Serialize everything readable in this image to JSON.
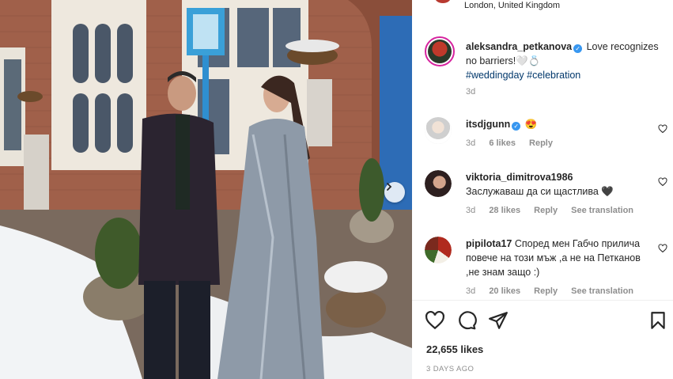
{
  "post": {
    "location": "London, United Kingdom",
    "author": "aleksandra_petkanova",
    "caption_text": "Love recognizes no barriers!🤍💍",
    "hashtags": "#weddingday #celebration",
    "time_ago": "3d",
    "likes": "22,655 likes",
    "date": "3 DAYS AGO"
  },
  "comments": [
    {
      "username": "itsdjgunn",
      "verified": true,
      "text": "😍",
      "time": "3d",
      "likes": "6 likes",
      "reply": "Reply",
      "avatar_color": "#d9d9d9"
    },
    {
      "username": "viktoria_dimitrova1986",
      "verified": false,
      "text": "Заслужаваш да си щастлива 🖤",
      "time": "3d",
      "likes": "28 likes",
      "reply": "Reply",
      "translate": "See translation",
      "avatar_color": "#3a2b2b"
    },
    {
      "username": "pipilota17",
      "verified": false,
      "text": "Според мен Габчо прилича повече на този мъж ,а не на Петканов ,не знам защо :)",
      "time": "3d",
      "likes": "20 likes",
      "reply": "Reply",
      "translate": "See translation",
      "avatar_color": "#7a2a1e"
    }
  ],
  "icons": {
    "like": "heart-icon",
    "comment": "comment-icon",
    "share": "share-icon",
    "save": "bookmark-icon",
    "next": "chevron-right-icon",
    "verified": "verified-badge-icon"
  },
  "colors": {
    "accent": "#3897f0",
    "hashtag": "#00376b",
    "muted": "#8e8e8e",
    "story_ring": "#d6249f"
  }
}
